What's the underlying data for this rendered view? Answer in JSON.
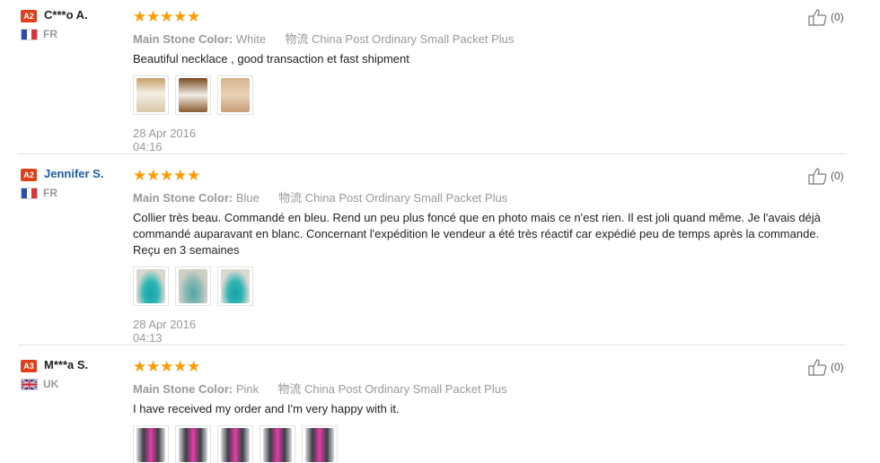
{
  "labels": {
    "main_stone": "Main Stone Color:",
    "logistics": "物流"
  },
  "reviews": [
    {
      "level": "A2",
      "level_color": "#e0401c",
      "user": "C***o A.",
      "user_is_link": false,
      "country": "FR",
      "flag": "fr",
      "rating": 5,
      "stone_color": "White",
      "shipping": "China Post Ordinary Small Packet Plus",
      "text": "Beautiful necklace , good transaction et fast shipment",
      "photos": [
        "necklace-white-photo",
        "necklace-white-photo",
        "necklace-white-photo"
      ],
      "date": "28 Apr 2016 04:16",
      "helpful": "(0)"
    },
    {
      "level": "A2",
      "level_color": "#e0401c",
      "user": "Jennifer S.",
      "user_is_link": true,
      "country": "FR",
      "flag": "fr",
      "rating": 5,
      "stone_color": "Blue",
      "shipping": "China Post Ordinary Small Packet Plus",
      "text": "Collier très beau. Commandé en bleu. Rend un peu plus foncé que en photo mais ce n'est rien. Il est joli quand même. Je l'avais déjà commandé auparavant en blanc. Concernant l'expédition le vendeur a été très réactif car expédié peu de temps après la commande. Reçu en 3 semaines",
      "photos": [
        "necklace-blue-photo",
        "necklace-blue-photo",
        "necklace-blue-photo"
      ],
      "date": "28 Apr 2016 04:13",
      "helpful": "(0)"
    },
    {
      "level": "A3",
      "level_color": "#e0401c",
      "user": "M***a S.",
      "user_is_link": false,
      "country": "UK",
      "flag": "uk",
      "rating": 5,
      "stone_color": "Pink",
      "shipping": "China Post Ordinary Small Packet Plus",
      "text": "I have received my order and I'm very happy with it.",
      "photos": [
        "necklace-pink-photo",
        "necklace-pink-photo",
        "necklace-pink-photo",
        "necklace-pink-photo",
        "necklace-pink-photo"
      ],
      "date": "",
      "helpful": "(0)"
    }
  ],
  "colors": {
    "star": "#ff9a00",
    "badge": "#e0401c",
    "link": "#1e5fa8",
    "muted": "#999999"
  }
}
